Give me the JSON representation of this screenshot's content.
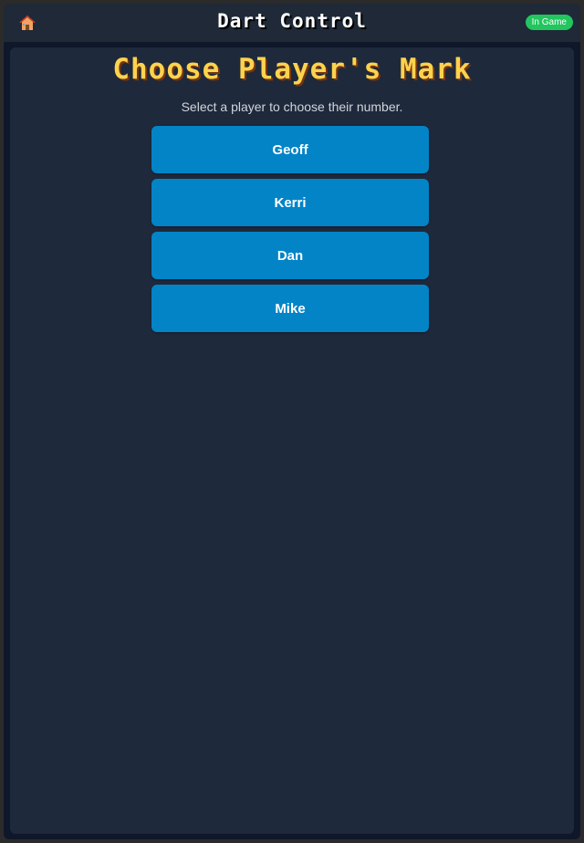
{
  "header": {
    "home_icon": "house-icon",
    "title": "Dart Control",
    "status_badge": "In Game",
    "status_color": "#22c55e"
  },
  "main": {
    "title": "Choose Player's Mark",
    "subtitle": "Select a player to choose their number.",
    "players": [
      {
        "label": "Geoff"
      },
      {
        "label": "Kerri"
      },
      {
        "label": "Dan"
      },
      {
        "label": "Mike"
      }
    ]
  },
  "colors": {
    "accent_title": "#fcd34d",
    "button": "#0284c7",
    "panel": "#1e293b",
    "background": "#0f172a"
  }
}
